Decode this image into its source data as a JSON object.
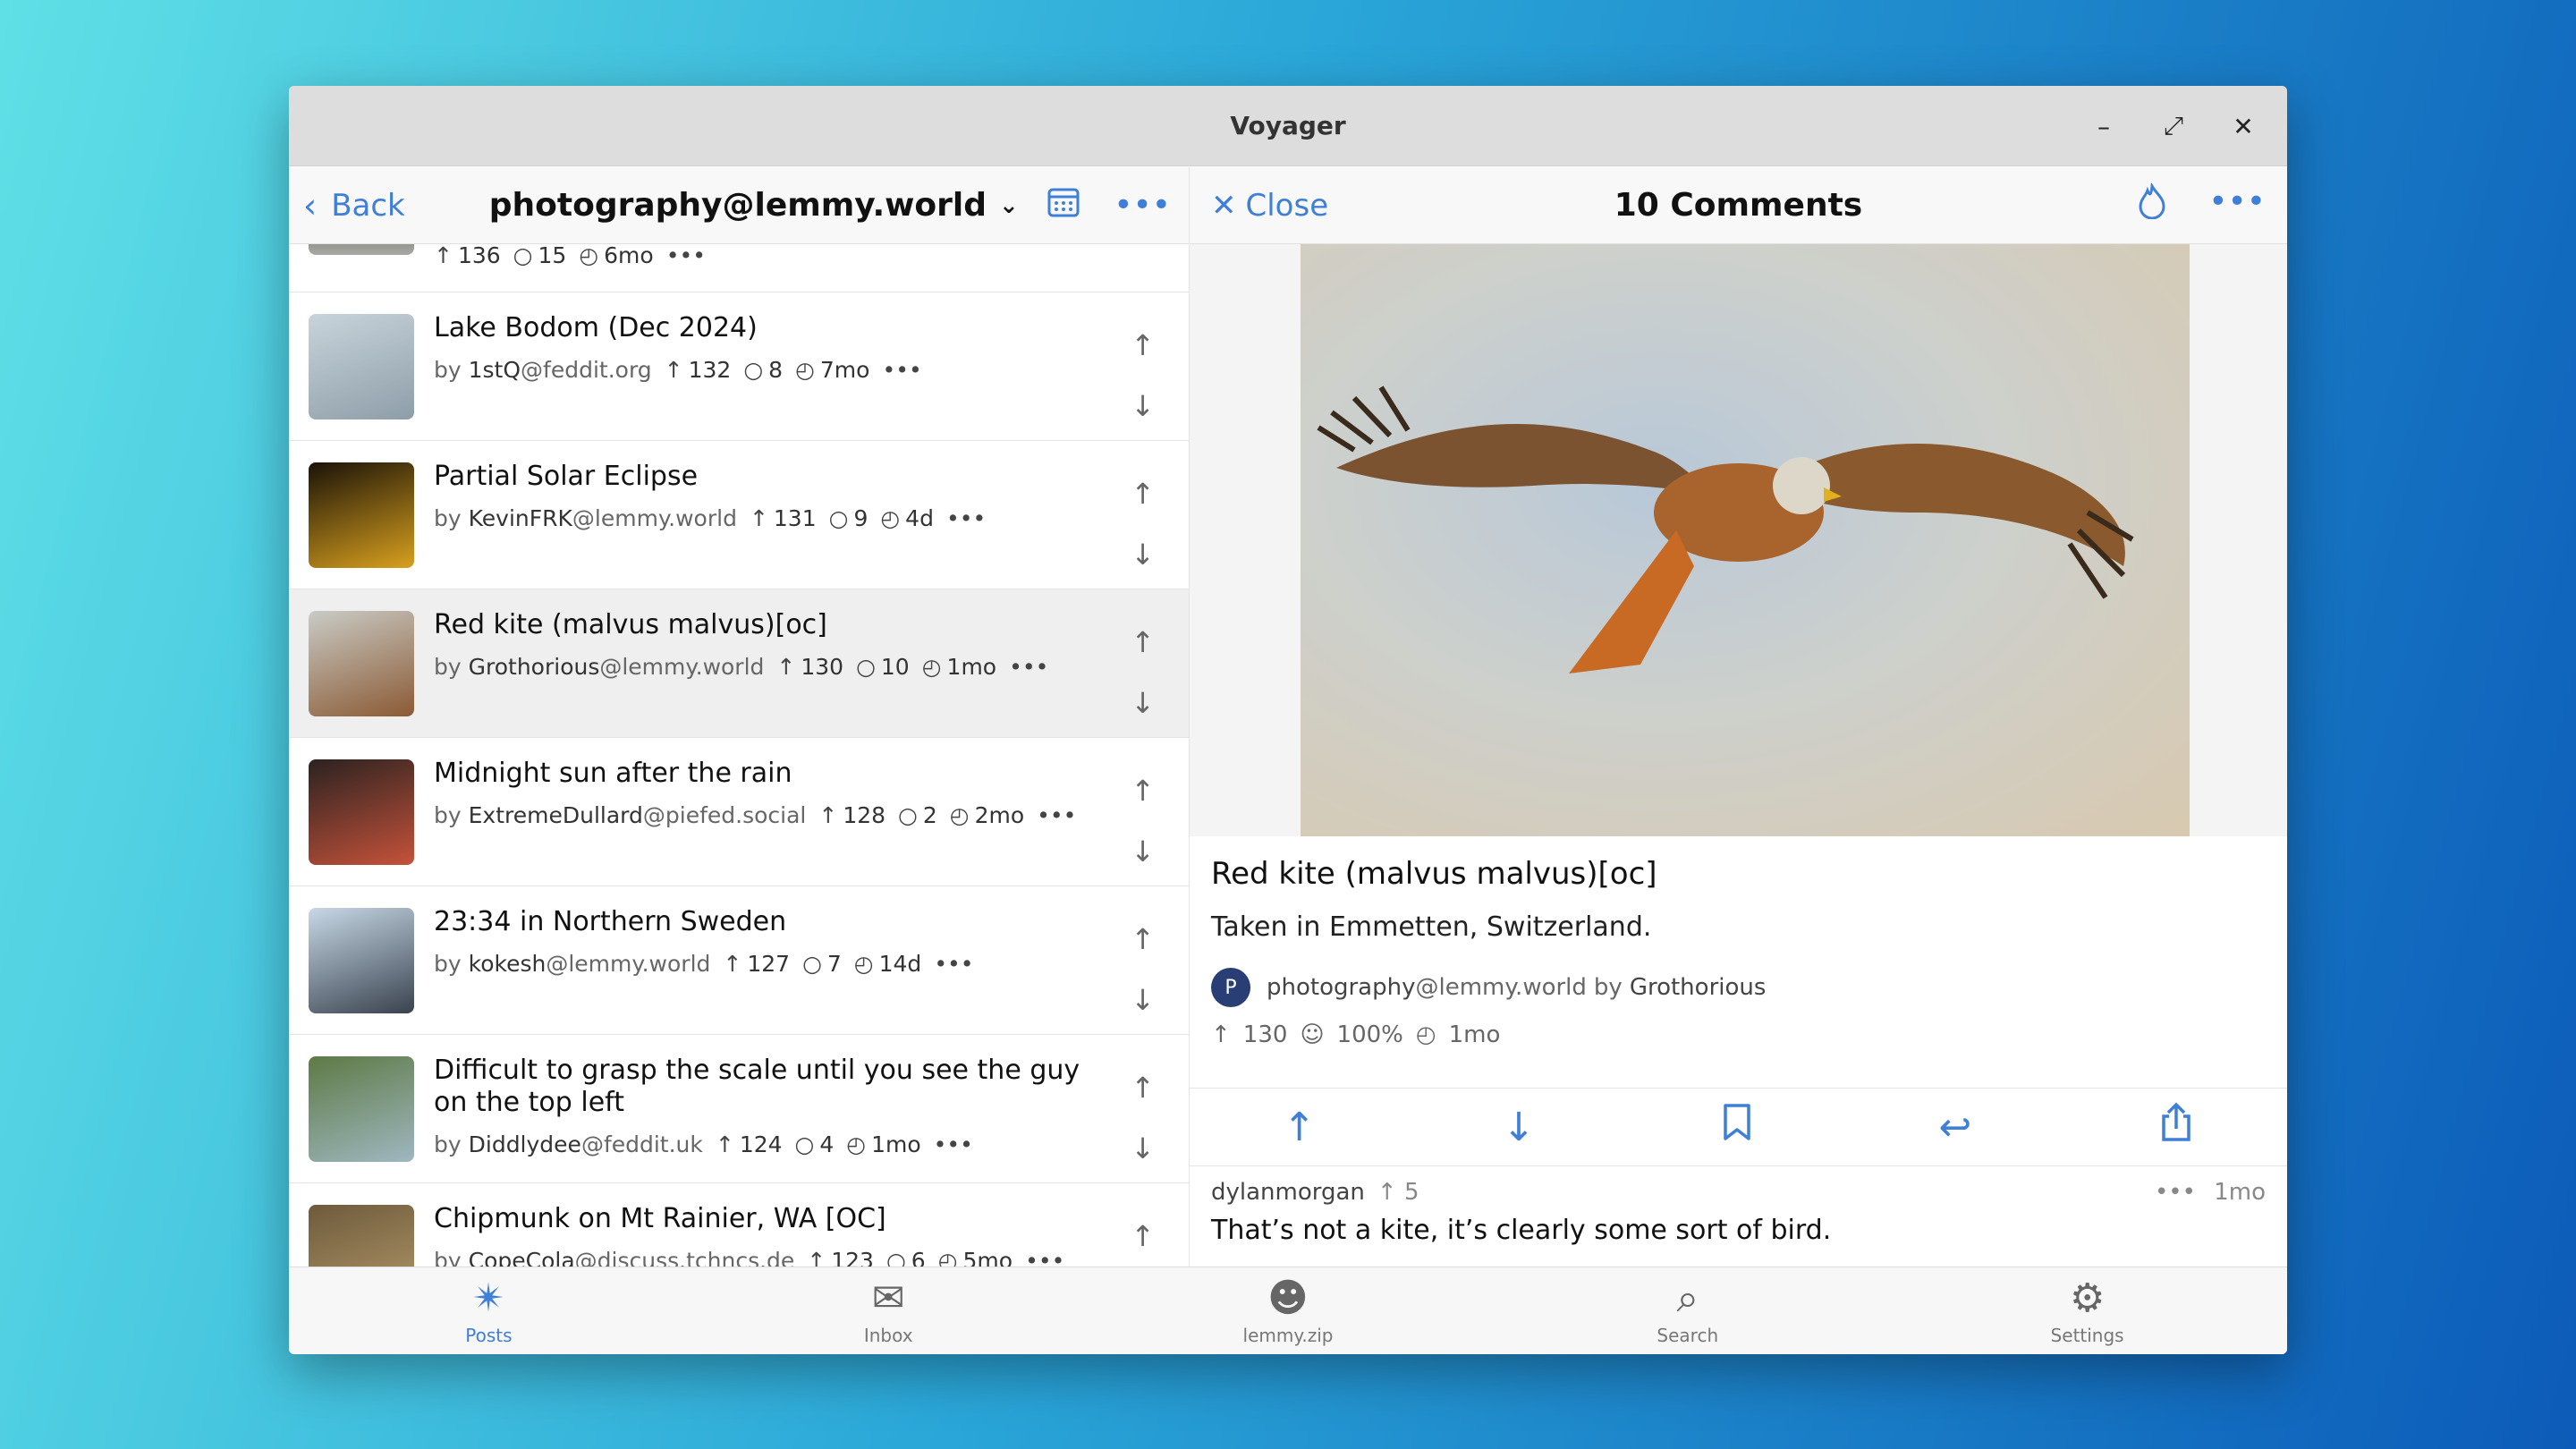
{
  "window": {
    "title": "Voyager"
  },
  "left_nav": {
    "back_label": "Back",
    "community": "photography@lemmy.world"
  },
  "posts": [
    {
      "title": "",
      "author": "",
      "instance": "",
      "score": "136",
      "comments": "15",
      "age": "6mo",
      "colors": [
        "#8a8a86",
        "#a9a9a4"
      ]
    },
    {
      "title": "Lake Bodom (Dec 2024)",
      "author": "1stQ",
      "instance": "@feddit.org",
      "score": "132",
      "comments": "8",
      "age": "7mo",
      "colors": [
        "#c8d4dc",
        "#8e9ea8"
      ]
    },
    {
      "title": "Partial Solar Eclipse",
      "author": "KevinFRK",
      "instance": "@lemmy.world",
      "score": "131",
      "comments": "9",
      "age": "4d",
      "colors": [
        "#1b1308",
        "#d8a01e"
      ]
    },
    {
      "title": "Red kite (malvus malvus)[oc]",
      "author": "Grothorious",
      "instance": "@lemmy.world",
      "score": "130",
      "comments": "10",
      "age": "1mo",
      "colors": [
        "#c9cbc5",
        "#8b5a35"
      ]
    },
    {
      "title": "Midnight sun after the rain",
      "author": "ExtremeDullard",
      "instance": "@piefed.social",
      "score": "128",
      "comments": "2",
      "age": "2mo",
      "colors": [
        "#2b2220",
        "#c5523a"
      ]
    },
    {
      "title": "23:34 in Northern Sweden",
      "author": "kokesh",
      "instance": "@lemmy.world",
      "score": "127",
      "comments": "7",
      "age": "14d",
      "colors": [
        "#c8d8e6",
        "#39434f"
      ]
    },
    {
      "title": "Difficult to grasp the scale until you see the guy on the top left",
      "author": "Diddlydee",
      "instance": "@feddit.uk",
      "score": "124",
      "comments": "4",
      "age": "1mo",
      "colors": [
        "#5d7a45",
        "#9fb7c0"
      ]
    },
    {
      "title": "Chipmunk on Mt Rainier, WA [OC]",
      "author": "CopeCola",
      "instance": "@discuss.tchncs.de",
      "score": "123",
      "comments": "6",
      "age": "5mo",
      "colors": [
        "#6e5a3c",
        "#b49b6b"
      ]
    }
  ],
  "right_nav": {
    "close_label": "Close",
    "title": "10 Comments"
  },
  "post": {
    "title": "Red kite (malvus malvus)[oc]",
    "body": "Taken in Emmetten, Switzerland.",
    "avatar_letter": "P",
    "community_name": "photography",
    "community_instance": "@lemmy.world",
    "by_label": "by",
    "author": "Grothorious",
    "score": "130",
    "upvote_pct": "100%",
    "age": "1mo"
  },
  "comment": {
    "author": "dylanmorgan",
    "score": "5",
    "age": "1mo",
    "text": "That’s not a kite, it’s clearly some sort of bird."
  },
  "tabs": [
    {
      "label": "Posts",
      "icon": "telescope-icon"
    },
    {
      "label": "Inbox",
      "icon": "inbox-icon"
    },
    {
      "label": "lemmy.zip",
      "icon": "profile-icon"
    },
    {
      "label": "Search",
      "icon": "search-icon"
    },
    {
      "label": "Settings",
      "icon": "gear-icon"
    }
  ],
  "colors": {
    "accent": "#3f7fd8",
    "selected_row": "#efefef",
    "avatar": "#283e74"
  }
}
